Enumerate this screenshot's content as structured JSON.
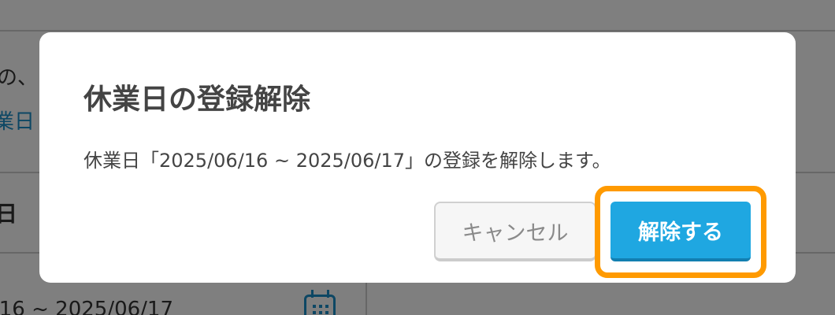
{
  "background": {
    "line1_fragment": "の、",
    "link_fragment": "業日",
    "row_label_fragment": "日",
    "date_fragment": "/16 ~ 2025/06/17",
    "calendar_icon": "calendar-icon"
  },
  "dialog": {
    "title": "休業日の登録解除",
    "message": "休業日「2025/06/16 ~ 2025/06/17」の登録を解除します。",
    "cancel_label": "キャンセル",
    "confirm_label": "解除する"
  },
  "colors": {
    "accent": "#1fa7e1",
    "highlight": "#ff9a00",
    "link": "#1a8fc9"
  }
}
